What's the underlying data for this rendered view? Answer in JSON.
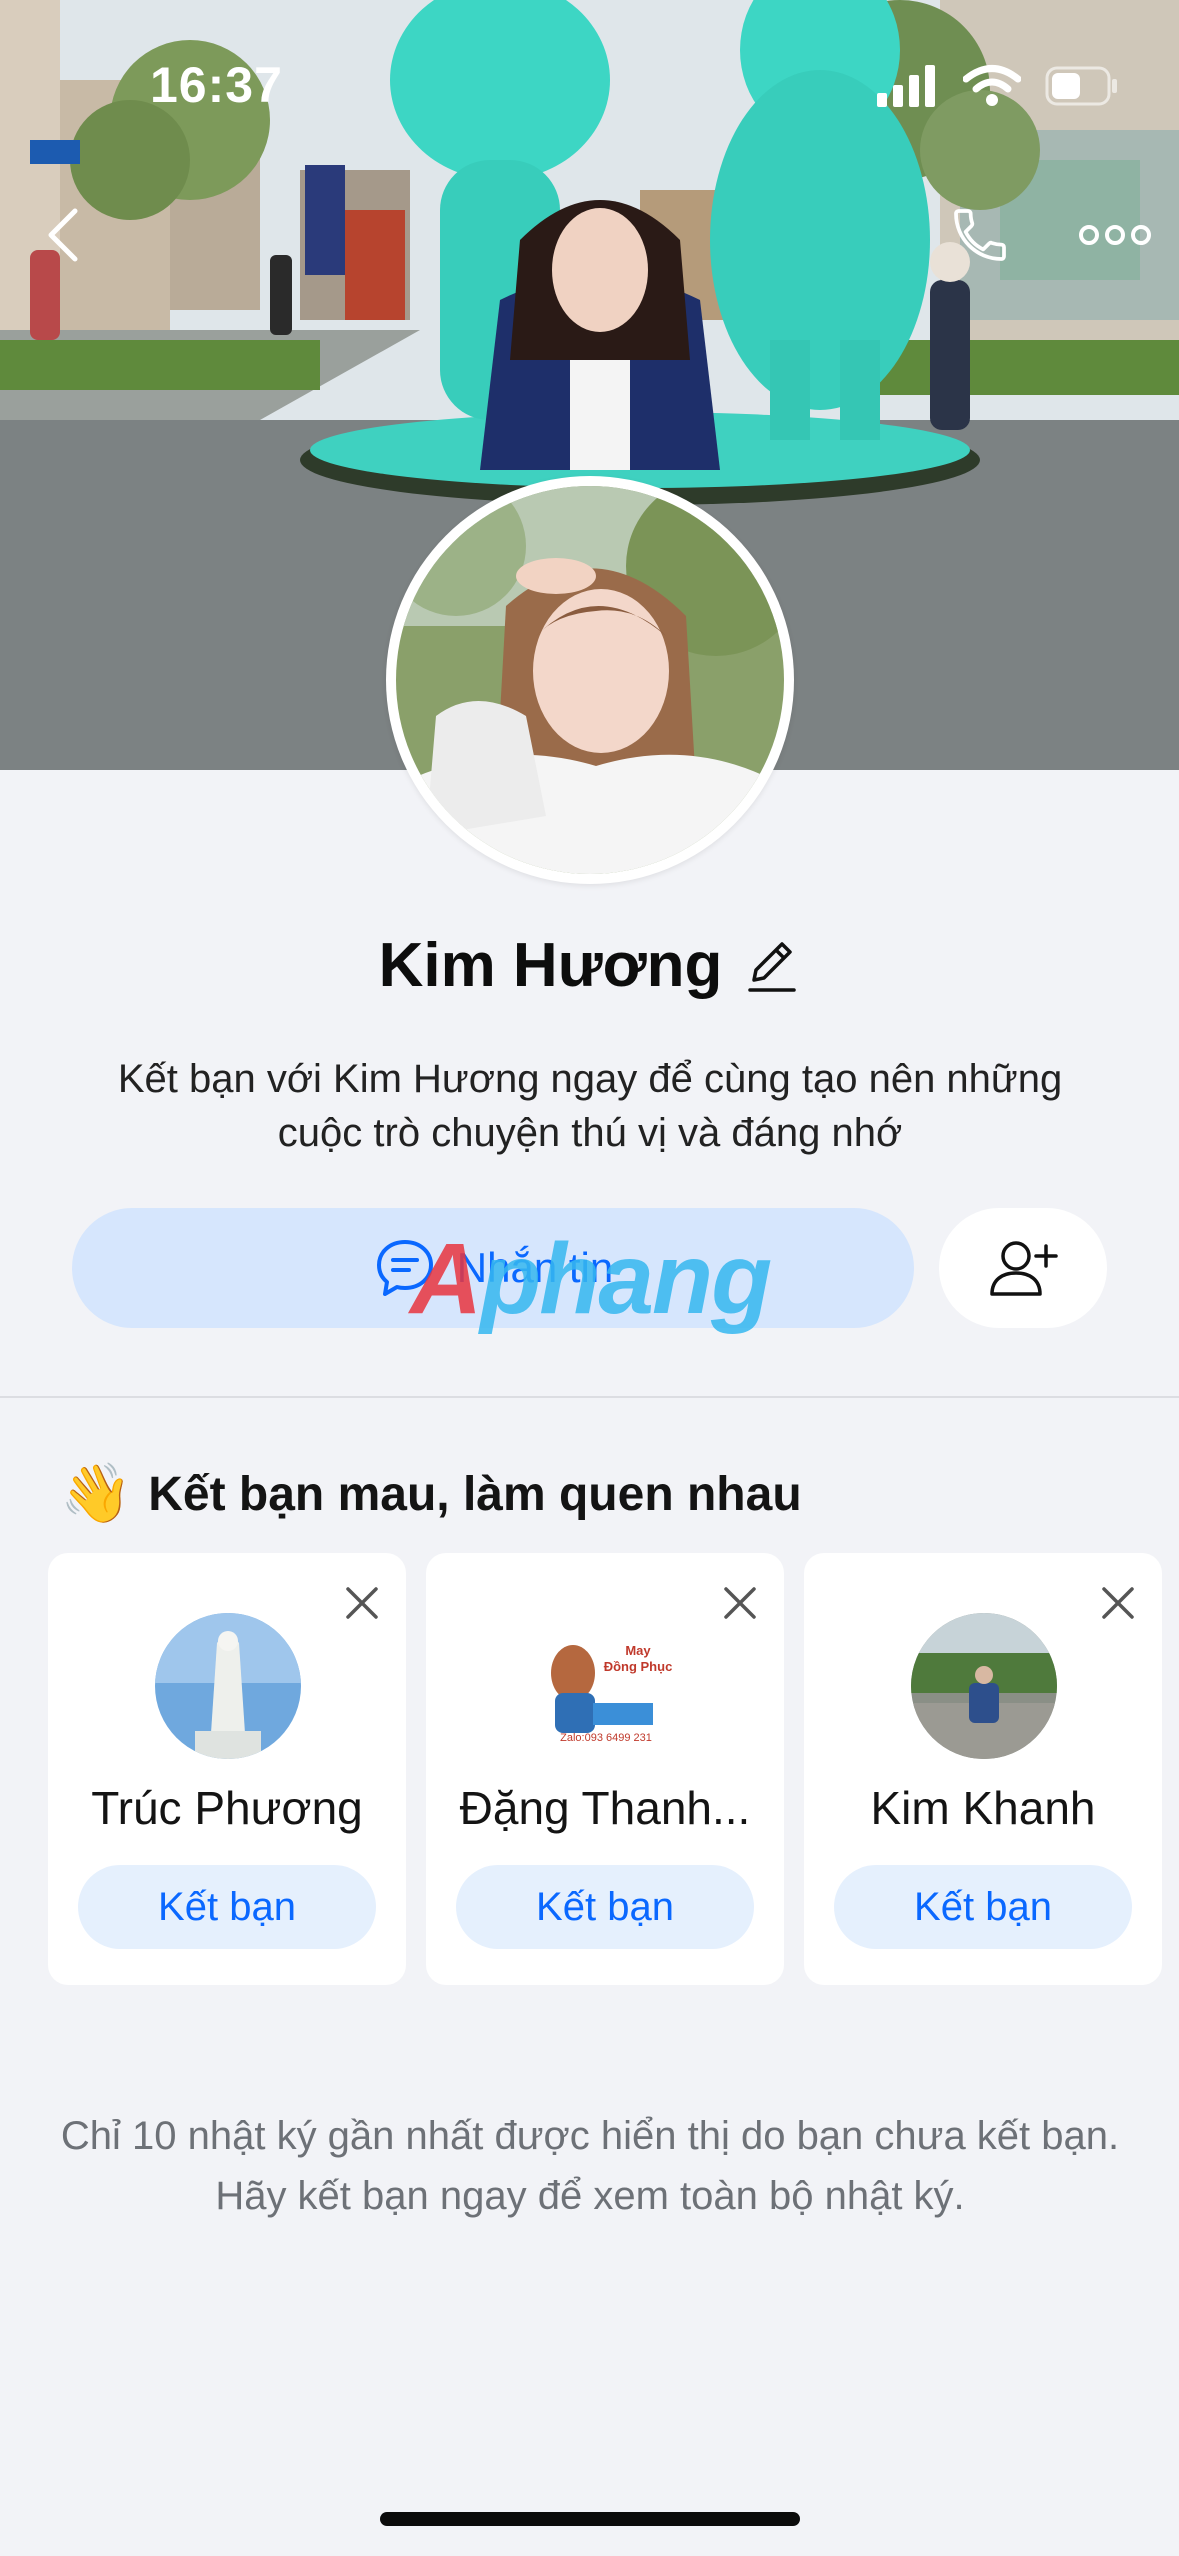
{
  "status_bar": {
    "time": "16:37",
    "icons": [
      "cellular-signal-icon",
      "wifi-icon",
      "battery-icon"
    ]
  },
  "header": {
    "back_icon": "chevron-left-icon",
    "call_icon": "phone-icon",
    "more_icon": "more-horizontal-icon"
  },
  "profile": {
    "name": "Kim Hương",
    "edit_icon": "pencil-icon",
    "description": "Kết bạn với Kim Hương ngay để cùng tạo nên những cuộc trò chuyện thú vị và đáng nhớ"
  },
  "actions": {
    "message_label": "Nhắn tin",
    "message_icon": "chat-bubble-icon",
    "add_friend_icon": "add-user-icon"
  },
  "watermark": {
    "part1": "A",
    "part2": "phang"
  },
  "suggestions": {
    "emoji": "👋",
    "title": "Kết bạn mau, làm quen nhau",
    "cards": [
      {
        "name": "Trúc Phương",
        "button": "Kết bạn"
      },
      {
        "name": "Đặng Thanh...",
        "button": "Kết bạn"
      },
      {
        "name": "Kim Khanh",
        "button": "Kết bạn"
      }
    ],
    "card_avatar_text": {
      "line1": "May",
      "line2": "Đồng Phục",
      "line3": "Zalo:093 6499 231"
    }
  },
  "note": "Chỉ 10 nhật ký gần nhất được hiển thị do bạn chưa kết bạn. Hãy kết bạn ngay để xem toàn bộ nhật ký.",
  "colors": {
    "accent": "#0a68ff",
    "message_button_bg": "#d6e6fd",
    "page_bg": "#f2f3f7",
    "muted_text": "#6d7177"
  }
}
